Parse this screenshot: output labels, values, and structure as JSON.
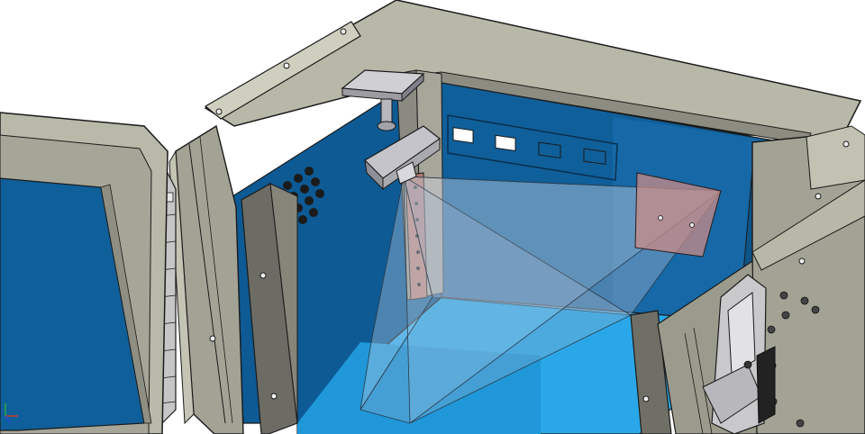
{
  "scene": {
    "subject": "cad-enclosure-camera-cutaway"
  },
  "colors": {
    "background": "#ffffff",
    "frame_light": "#b9b9a9",
    "frame_mid": "#a3a395",
    "frame_dark": "#6f6f66",
    "panel_blue": "#0f5f9a",
    "panel_blue_light": "#1d8fd6",
    "floor_blue": "#2aa7e8",
    "camera_gray": "#c8c8cc",
    "field_of_view": "#c9d6e6",
    "highlight_red": "#b97a78",
    "edge": "#1a1a1a"
  },
  "icons": {
    "vent": "hex-vent-grille",
    "hinge": "door-hinge",
    "camera": "camera-unit",
    "latch": "latch-bracket",
    "axis": "coordinate-axis-triad"
  }
}
